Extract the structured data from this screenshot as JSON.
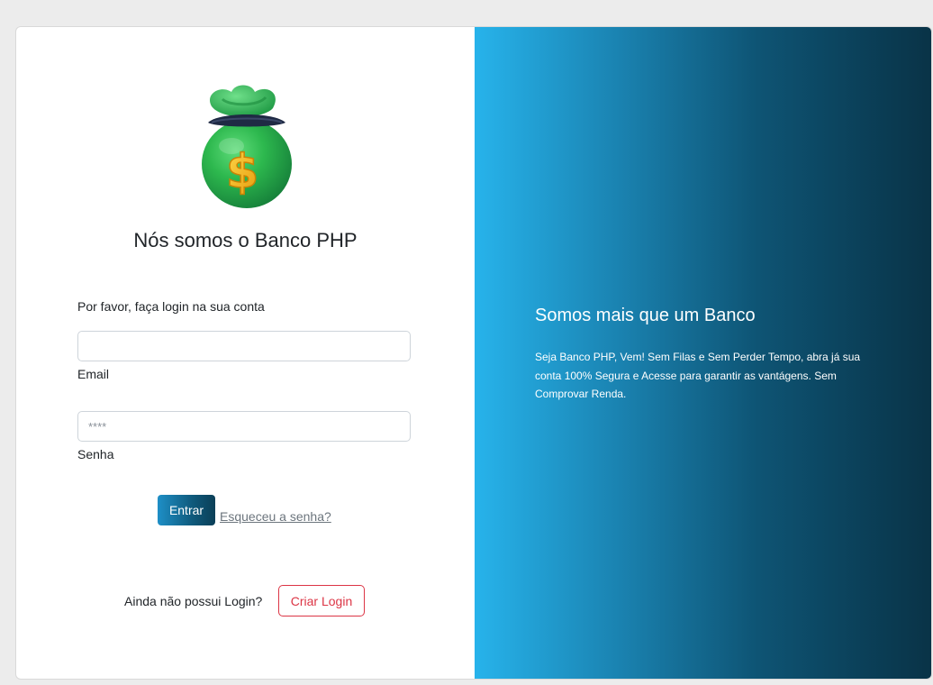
{
  "brand": {
    "logo_icon": "money-bag-icon",
    "title": "Nós somos o Banco PHP"
  },
  "login_form": {
    "prompt": "Por favor, faça login na sua conta",
    "email": {
      "label": "Email",
      "value": "",
      "placeholder": ""
    },
    "password": {
      "label": "Senha",
      "placeholder": "****"
    },
    "submit_label": "Entrar",
    "forgot_label": "Esqueceu a senha?"
  },
  "signup": {
    "text": "Ainda não possui Login?",
    "button_label": "Criar Login"
  },
  "promo": {
    "title": "Somos mais que um Banco",
    "text": "Seja Banco PHP, Vem! Sem Filas e Sem Perder Tempo, abra já sua conta 100% Segura e Acesse para garantir as vantágens. Sem Comprovar Renda."
  },
  "colors": {
    "primary_gradient_start": "#27b3eb",
    "primary_gradient_end": "#093347",
    "danger": "#dc3545",
    "bag_green": "#2db84e",
    "dollar_gold": "#f5b81c"
  }
}
